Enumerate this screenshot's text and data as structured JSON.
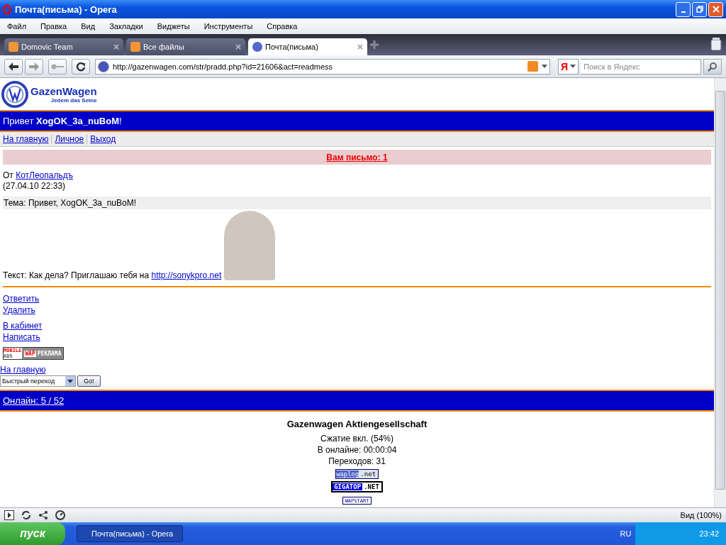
{
  "window": {
    "title": "Почта(письма) - Opera"
  },
  "menu": [
    "Файл",
    "Правка",
    "Вид",
    "Закладки",
    "Виджеты",
    "Инструменты",
    "Справка"
  ],
  "tabs": [
    {
      "label": "Domovic Team",
      "selected": false
    },
    {
      "label": "Все файлы",
      "selected": false
    },
    {
      "label": "Почта(письма)",
      "selected": true
    }
  ],
  "address": {
    "url": "http://gazenwagen.com/str/pradd.php?id=21606&act=readmess"
  },
  "search": {
    "engine": "Я",
    "placeholder": "Поиск в Яндекс"
  },
  "page": {
    "logo": {
      "name": "GazenWagen",
      "slogan": "Jedem das Seine"
    },
    "greeting": "Привет **XogOK_3a_nuBoM**!",
    "nav": [
      "На главную",
      "Личное",
      "Выход"
    ],
    "mail_notice": "Вам письмо: 1",
    "from_label": "От",
    "from_user": "КотЛеопальдъ",
    "date": "(27.04.10 22:33)",
    "subject": "Тема: Привет, XogOK_3a_nuBoM!",
    "text": "Текст: Как дела? Приглашаю тебя на",
    "text_link": "http://sonykpro.net",
    "actions": [
      [
        "Ответить",
        "Удалить"
      ],
      [
        "В кабинет",
        "Написать"
      ]
    ],
    "ad_banner": {
      "top": "MOBILE",
      "bottom": "ADS",
      "wap": "WAP",
      "label": "РЕКЛАМА"
    },
    "home_link": "На главную",
    "quick_jump": {
      "value": "Быстрый переход",
      "button": "Go!"
    },
    "online": "Онлайн: 5 / 52",
    "footer": {
      "company": "Gazenwagen Aktiengesellschaft",
      "lines": [
        "Сжатие вкл. (54%)",
        "В онлайне: 00:00:04",
        "Переходов: 31"
      ],
      "counters": [
        {
          "kind": "waplog",
          "brand": "waplog",
          "suffix": ".net"
        },
        {
          "kind": "gigatop",
          "brand": "GIGATOP",
          "suffix": ".NET"
        },
        {
          "kind": "wapstart",
          "brand": "WAPSTART"
        }
      ]
    }
  },
  "status_bar": {
    "zoom": "Вид (100%)"
  },
  "taskbar": {
    "start": "пуск",
    "task": "Почта(письма) - Opera",
    "lang": "RU",
    "clock": "23:42"
  }
}
